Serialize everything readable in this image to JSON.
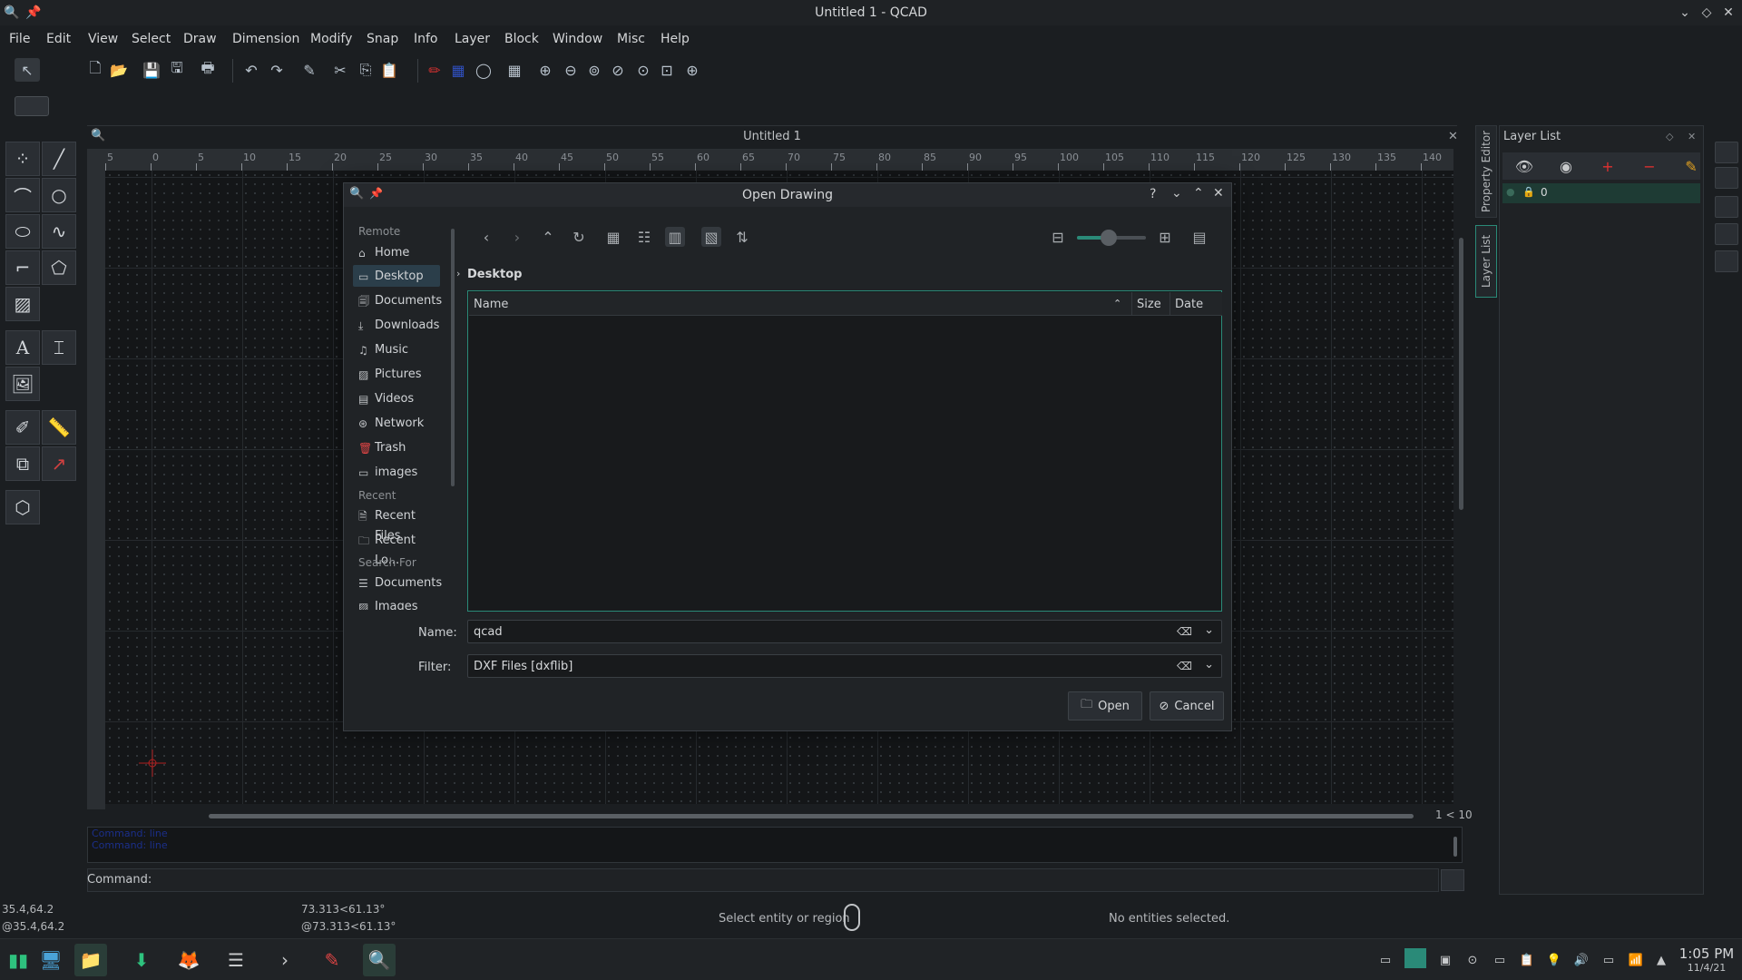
{
  "window": {
    "title": "Untitled 1 - QCAD"
  },
  "menu": [
    "File",
    "Edit",
    "View",
    "Select",
    "Draw",
    "Dimension",
    "Modify",
    "Snap",
    "Info",
    "Layer",
    "Block",
    "Window",
    "Misc",
    "Help"
  ],
  "document": {
    "title": "Untitled 1",
    "zoom": "1 < 10"
  },
  "ruler_ticks": [
    "5",
    "0",
    "5",
    "10",
    "15",
    "20",
    "25",
    "30",
    "35",
    "40",
    "45",
    "50",
    "55",
    "60",
    "65",
    "70",
    "75",
    "80",
    "85",
    "90",
    "95",
    "100",
    "105",
    "110",
    "115",
    "120",
    "125",
    "130",
    "135",
    "140"
  ],
  "history": [
    "Command: line",
    "Command: line"
  ],
  "command": {
    "label": "Command:"
  },
  "status": {
    "coord_abs": "35.4,64.2",
    "coord_rel": "@35.4,64.2",
    "polar_abs": "73.313<61.13°",
    "polar_rel": "@73.313<61.13°",
    "hint": "Select entity or region",
    "selection": "No entities selected."
  },
  "side_tabs": [
    "Property Editor",
    "Layer List"
  ],
  "layer_panel": {
    "title": "Layer List",
    "layers": [
      {
        "name": "0",
        "color": "#1e3b34"
      }
    ]
  },
  "dialog": {
    "title": "Open Drawing",
    "places_sections": [
      "Remote",
      "Recent",
      "Search For"
    ],
    "places": [
      {
        "label": "Home",
        "icon": "home-icon"
      },
      {
        "label": "Desktop",
        "icon": "desktop-icon"
      },
      {
        "label": "Documents",
        "icon": "documents-icon"
      },
      {
        "label": "Downloads",
        "icon": "downloads-icon"
      },
      {
        "label": "Music",
        "icon": "music-icon"
      },
      {
        "label": "Pictures",
        "icon": "pictures-icon"
      },
      {
        "label": "Videos",
        "icon": "videos-icon"
      },
      {
        "label": "Network",
        "icon": "network-icon"
      },
      {
        "label": "Trash",
        "icon": "trash-icon"
      },
      {
        "label": "images",
        "icon": "folder-icon"
      },
      {
        "label": "Recent Files",
        "icon": "recent-files-icon"
      },
      {
        "label": "Recent Lo...",
        "icon": "recent-locations-icon"
      },
      {
        "label": "Documents",
        "icon": "search-documents-icon"
      },
      {
        "label": "Images",
        "icon": "search-images-icon"
      }
    ],
    "breadcrumb": "Desktop",
    "columns": [
      "Name",
      "Size",
      "Date"
    ],
    "name_label": "Name:",
    "name_value": "qcad",
    "filter_label": "Filter:",
    "filter_value": "DXF Files [dxflib]",
    "open_label": "Open",
    "cancel_label": "Cancel"
  },
  "clock": {
    "time": "1:05 PM",
    "date": "11/4/21"
  },
  "colors": {
    "accent": "#2a8a78",
    "selected_place": "#2b3e4a",
    "history_text": "#1b2f8a"
  }
}
